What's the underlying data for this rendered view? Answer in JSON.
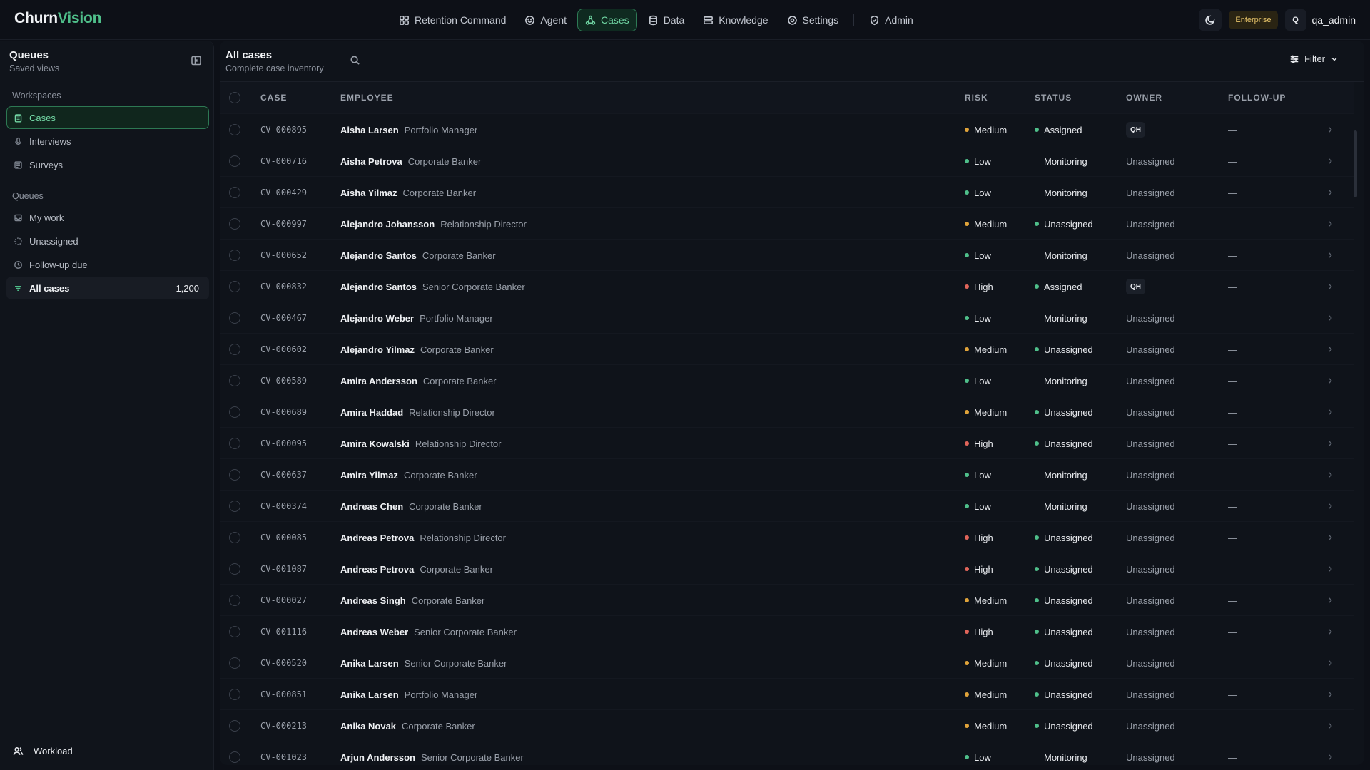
{
  "brand": {
    "part1": "Churn",
    "part2": "Vision",
    "accent": "#4fbf8a"
  },
  "nav": {
    "items": [
      {
        "label": "Retention Command",
        "icon": "command-center-icon",
        "active": false
      },
      {
        "label": "Agent",
        "icon": "agent-icon",
        "active": false
      },
      {
        "label": "Cases",
        "icon": "cases-icon",
        "active": true
      },
      {
        "label": "Data",
        "icon": "database-icon",
        "active": false
      },
      {
        "label": "Knowledge",
        "icon": "knowledge-icon",
        "active": false
      },
      {
        "label": "Settings",
        "icon": "gear-icon",
        "active": false
      }
    ],
    "admin_label": "Admin"
  },
  "topright": {
    "plan": "Enterprise",
    "user_initial": "Q",
    "username": "qa_admin"
  },
  "sidebar": {
    "title": "Queues",
    "subtitle": "Saved views",
    "workspaces_label": "Workspaces",
    "workspaces": [
      {
        "label": "Cases",
        "icon": "clipboard-icon"
      },
      {
        "label": "Interviews",
        "icon": "microphone-icon"
      },
      {
        "label": "Surveys",
        "icon": "survey-icon"
      }
    ],
    "queues_label": "Queues",
    "queues": [
      {
        "label": "My work",
        "icon": "inbox-icon",
        "count": ""
      },
      {
        "label": "Unassigned",
        "icon": "dashed-circle-icon",
        "count": ""
      },
      {
        "label": "Follow-up due",
        "icon": "clock-icon",
        "count": ""
      },
      {
        "label": "All cases",
        "icon": "filter-lines-icon",
        "count": "1,200"
      }
    ],
    "footer_label": "Workload"
  },
  "main": {
    "title": "All cases",
    "subtitle": "Complete case inventory",
    "filter_label": "Filter",
    "columns": {
      "case": "CASE",
      "employee": "EMPLOYEE",
      "risk": "RISK",
      "status": "STATUS",
      "owner": "OWNER",
      "followup": "FOLLOW-UP"
    },
    "colors": {
      "medium": "#e0a33a",
      "low": "#4fbf8a",
      "high": "#e0655a",
      "status_dot": "#4fbf8a"
    },
    "rows": [
      {
        "case": "CV-000895",
        "name": "Aisha Larsen",
        "role": "Portfolio Manager",
        "risk": "Medium",
        "status": "Assigned",
        "owner": "QH",
        "followup": "—"
      },
      {
        "case": "CV-000716",
        "name": "Aisha Petrova",
        "role": "Corporate Banker",
        "risk": "Low",
        "status": "Monitoring",
        "owner": "Unassigned",
        "followup": "—"
      },
      {
        "case": "CV-000429",
        "name": "Aisha Yilmaz",
        "role": "Corporate Banker",
        "risk": "Low",
        "status": "Monitoring",
        "owner": "Unassigned",
        "followup": "—"
      },
      {
        "case": "CV-000997",
        "name": "Alejandro Johansson",
        "role": "Relationship Director",
        "risk": "Medium",
        "status": "Unassigned",
        "owner": "Unassigned",
        "followup": "—"
      },
      {
        "case": "CV-000652",
        "name": "Alejandro Santos",
        "role": "Corporate Banker",
        "risk": "Low",
        "status": "Monitoring",
        "owner": "Unassigned",
        "followup": "—"
      },
      {
        "case": "CV-000832",
        "name": "Alejandro Santos",
        "role": "Senior Corporate Banker",
        "risk": "High",
        "status": "Assigned",
        "owner": "QH",
        "followup": "—"
      },
      {
        "case": "CV-000467",
        "name": "Alejandro Weber",
        "role": "Portfolio Manager",
        "risk": "Low",
        "status": "Monitoring",
        "owner": "Unassigned",
        "followup": "—"
      },
      {
        "case": "CV-000602",
        "name": "Alejandro Yilmaz",
        "role": "Corporate Banker",
        "risk": "Medium",
        "status": "Unassigned",
        "owner": "Unassigned",
        "followup": "—"
      },
      {
        "case": "CV-000589",
        "name": "Amira Andersson",
        "role": "Corporate Banker",
        "risk": "Low",
        "status": "Monitoring",
        "owner": "Unassigned",
        "followup": "—"
      },
      {
        "case": "CV-000689",
        "name": "Amira Haddad",
        "role": "Relationship Director",
        "risk": "Medium",
        "status": "Unassigned",
        "owner": "Unassigned",
        "followup": "—"
      },
      {
        "case": "CV-000095",
        "name": "Amira Kowalski",
        "role": "Relationship Director",
        "risk": "High",
        "status": "Unassigned",
        "owner": "Unassigned",
        "followup": "—"
      },
      {
        "case": "CV-000637",
        "name": "Amira Yilmaz",
        "role": "Corporate Banker",
        "risk": "Low",
        "status": "Monitoring",
        "owner": "Unassigned",
        "followup": "—"
      },
      {
        "case": "CV-000374",
        "name": "Andreas Chen",
        "role": "Corporate Banker",
        "risk": "Low",
        "status": "Monitoring",
        "owner": "Unassigned",
        "followup": "—"
      },
      {
        "case": "CV-000085",
        "name": "Andreas Petrova",
        "role": "Relationship Director",
        "risk": "High",
        "status": "Unassigned",
        "owner": "Unassigned",
        "followup": "—"
      },
      {
        "case": "CV-001087",
        "name": "Andreas Petrova",
        "role": "Corporate Banker",
        "risk": "High",
        "status": "Unassigned",
        "owner": "Unassigned",
        "followup": "—"
      },
      {
        "case": "CV-000027",
        "name": "Andreas Singh",
        "role": "Corporate Banker",
        "risk": "Medium",
        "status": "Unassigned",
        "owner": "Unassigned",
        "followup": "—"
      },
      {
        "case": "CV-001116",
        "name": "Andreas Weber",
        "role": "Senior Corporate Banker",
        "risk": "High",
        "status": "Unassigned",
        "owner": "Unassigned",
        "followup": "—"
      },
      {
        "case": "CV-000520",
        "name": "Anika Larsen",
        "role": "Senior Corporate Banker",
        "risk": "Medium",
        "status": "Unassigned",
        "owner": "Unassigned",
        "followup": "—"
      },
      {
        "case": "CV-000851",
        "name": "Anika Larsen",
        "role": "Portfolio Manager",
        "risk": "Medium",
        "status": "Unassigned",
        "owner": "Unassigned",
        "followup": "—"
      },
      {
        "case": "CV-000213",
        "name": "Anika Novak",
        "role": "Corporate Banker",
        "risk": "Medium",
        "status": "Unassigned",
        "owner": "Unassigned",
        "followup": "—"
      },
      {
        "case": "CV-001023",
        "name": "Arjun Andersson",
        "role": "Senior Corporate Banker",
        "risk": "Low",
        "status": "Monitoring",
        "owner": "Unassigned",
        "followup": "—"
      }
    ]
  }
}
